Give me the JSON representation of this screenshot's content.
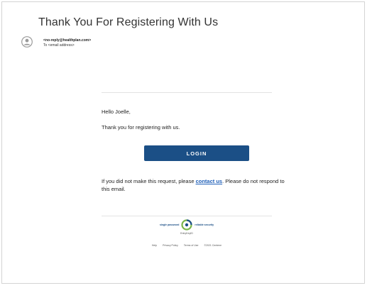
{
  "email": {
    "subject": "Thank You For Registering With Us",
    "sender": "<no-reply@healthplan.com>",
    "to": "To <email address>"
  },
  "body": {
    "greeting": "Hello Joelle,",
    "thanks": "Thank you for registering with us.",
    "login_label": "LOGIN",
    "note_before": "If you did not make this request, please ",
    "contact_link": "contact us",
    "note_after": ". Please do not respond to this email."
  },
  "footer": {
    "tag_left": "single password",
    "tag_right": "reliable security",
    "brand": "EntryKeyID",
    "links": [
      "Help",
      "Privacy Policy",
      "Terms of Use",
      "©2021 Centene"
    ]
  },
  "colors": {
    "button": "#1b4f86",
    "link": "#1f5fb8",
    "logo_green": "#7ab648"
  }
}
